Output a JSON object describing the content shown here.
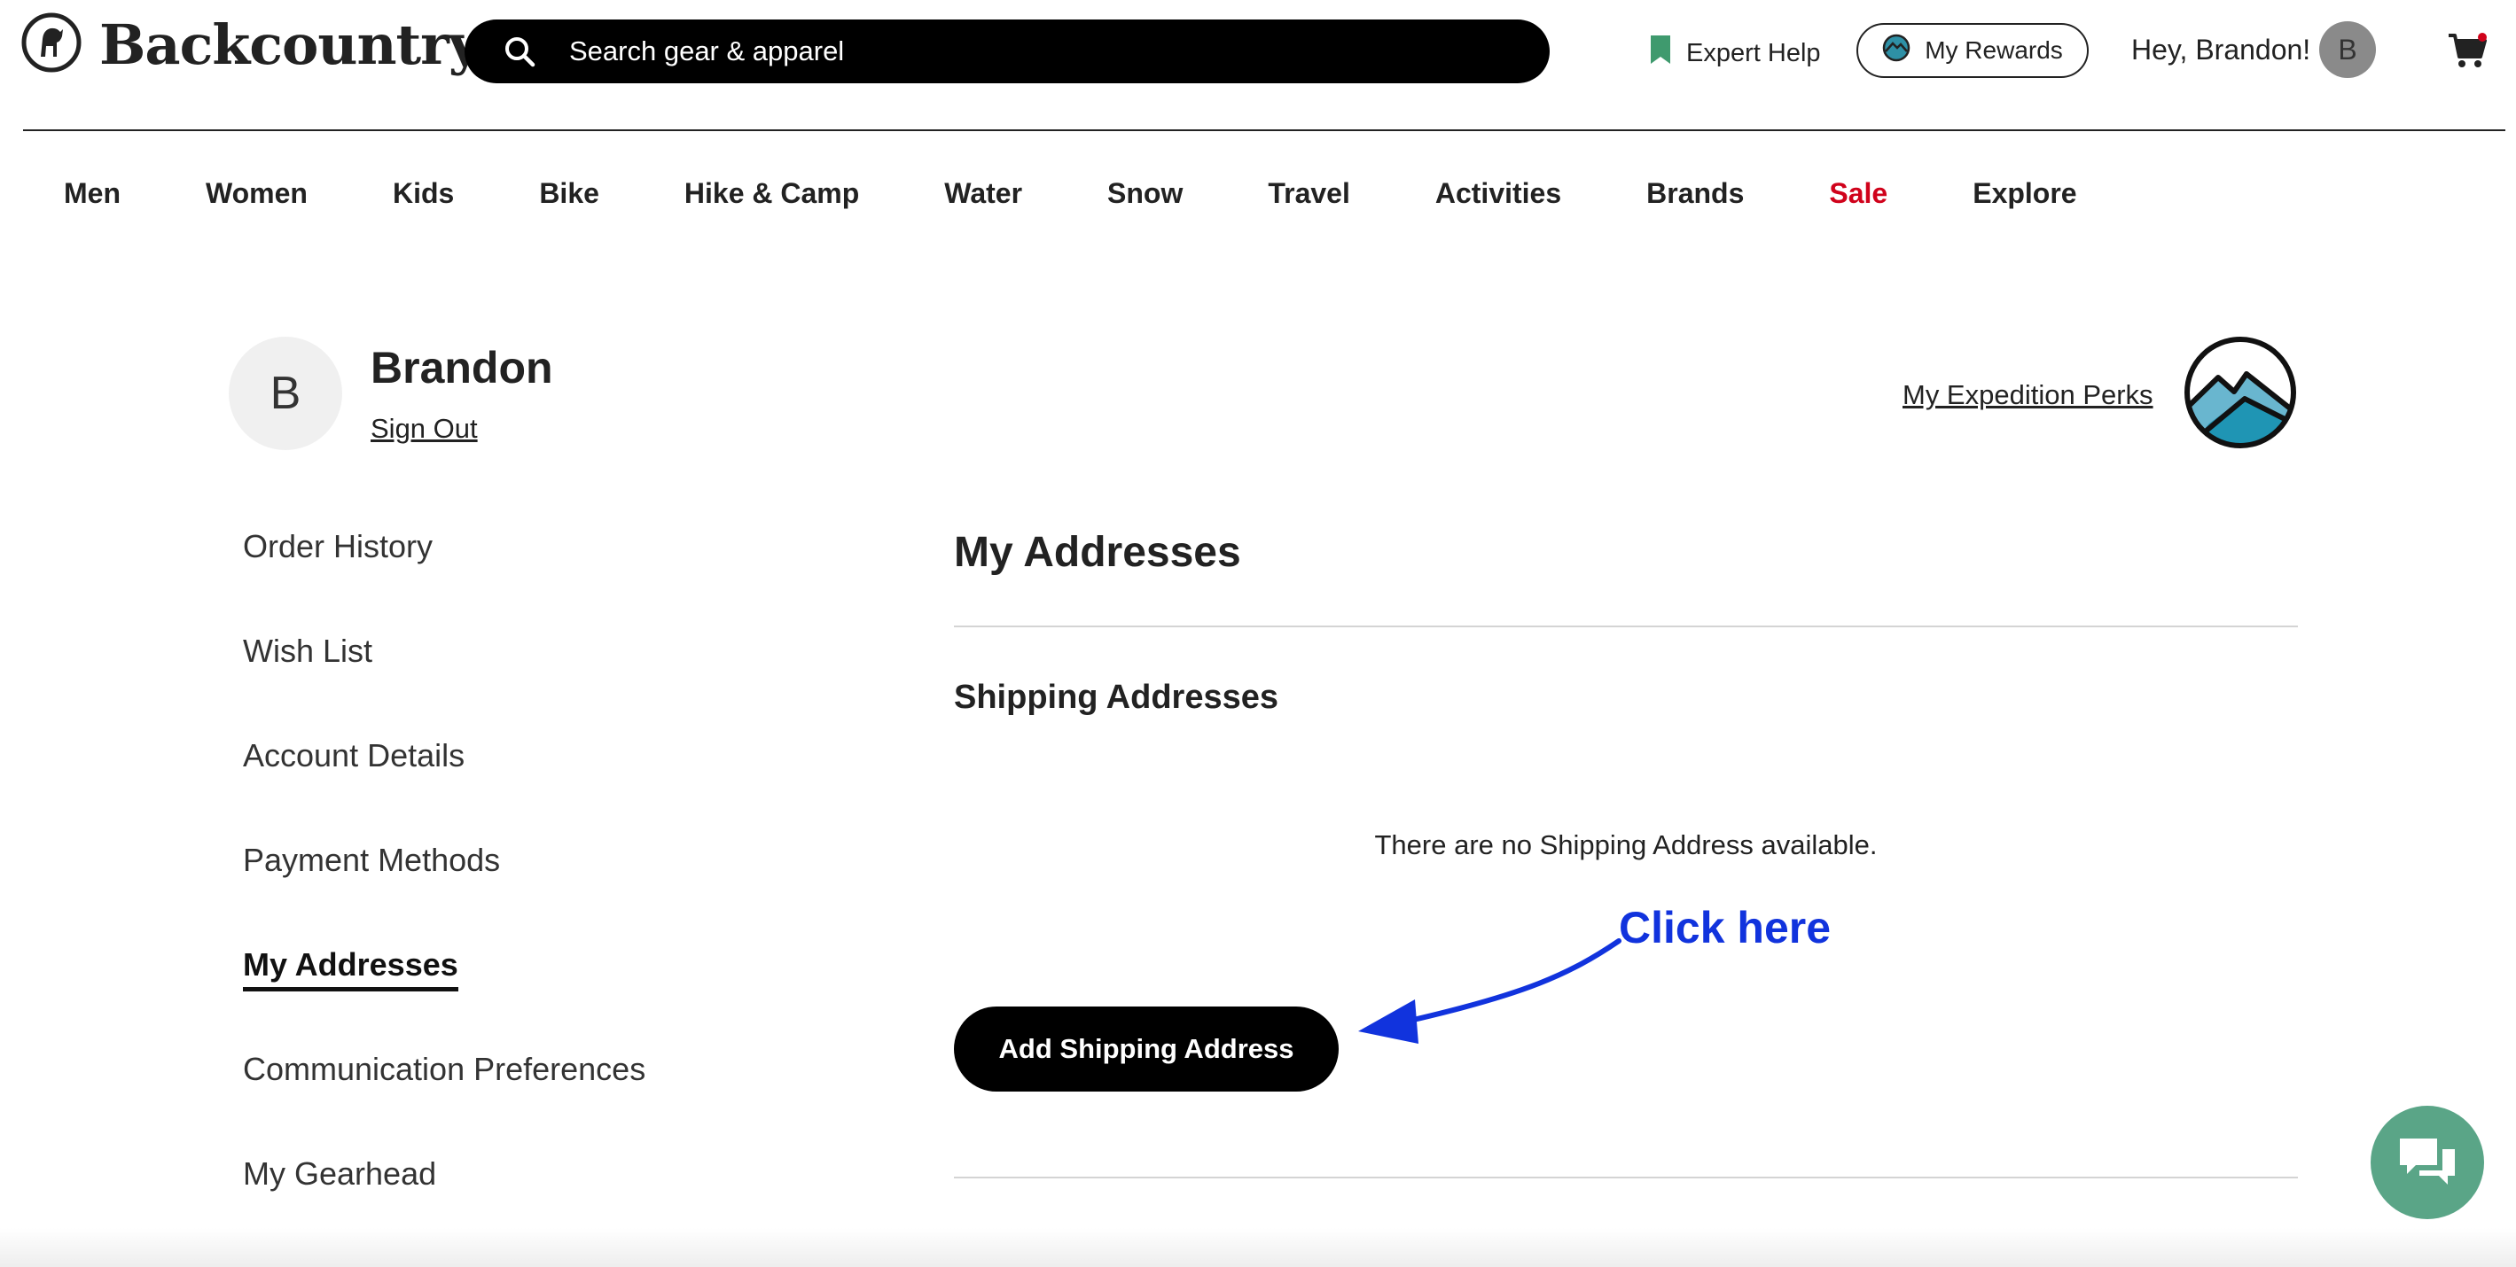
{
  "header": {
    "logo_text": "Backcountry",
    "search_placeholder": "Search gear & apparel",
    "expert_help": "Expert Help",
    "rewards": "My Rewards",
    "greeting": "Hey, Brandon!",
    "avatar_initial": "B"
  },
  "nav": {
    "items": [
      "Men",
      "Women",
      "Kids",
      "Bike",
      "Hike & Camp",
      "Water",
      "Snow",
      "Travel",
      "Activities",
      "Brands",
      "Sale",
      "Explore"
    ]
  },
  "profile": {
    "initial": "B",
    "name": "Brandon",
    "sign_out": "Sign Out",
    "perks_link": "My Expedition Perks"
  },
  "sidebar": {
    "items": [
      {
        "label": "Order History"
      },
      {
        "label": "Wish List"
      },
      {
        "label": "Account Details"
      },
      {
        "label": "Payment Methods"
      },
      {
        "label": "My Addresses",
        "active": true
      },
      {
        "label": "Communication Preferences"
      },
      {
        "label": "My Gearhead"
      }
    ]
  },
  "main": {
    "title": "My Addresses",
    "section_title": "Shipping Addresses",
    "empty_message": "There are no Shipping Address available.",
    "add_button": "Add Shipping Address"
  },
  "annotation": {
    "text": "Click here"
  },
  "colors": {
    "sale": "#d0021b",
    "annotation": "#1133dd",
    "chat": "#5aa587",
    "expert_bookmark": "#3f9a6e"
  }
}
